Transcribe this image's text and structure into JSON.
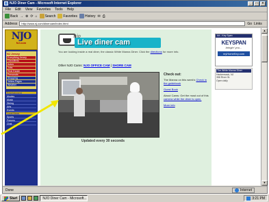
{
  "window": {
    "title": "NJO Diner Cam - Microsoft Internet Explorer",
    "controls": [
      "_",
      "□",
      "×"
    ]
  },
  "menubar": {
    "items": [
      "File",
      "Edit",
      "View",
      "Favorites",
      "Tools",
      "Help"
    ]
  },
  "toolbar": {
    "back": "Back",
    "forward": "→",
    "stop": "⊗",
    "refresh": "⟳",
    "home": "⌂",
    "search": "Search",
    "favorites": "Favorites",
    "history": "History",
    "mail": "✉",
    "print": "⎙"
  },
  "address": {
    "label": "Address",
    "url": "http://www.nj.com/dinercam/index.html",
    "go": "Go",
    "links": "Links"
  },
  "site": {
    "logo": "NJO",
    "logo_sub": "NJ.com",
    "nav_head": "NJ Jersey",
    "nav_red": [
      "Everything Jersey",
      "Classifieds",
      "Autos",
      "Jobs",
      "Real Estate",
      "Personals"
    ],
    "nav_blue": [
      "Shopping",
      "Yellow Pages",
      "Weather"
    ],
    "nav_section": "Entertainment",
    "nav_list": [
      "Movies",
      "Music",
      "Dining",
      "Arts",
      "Events"
    ],
    "nav_list2": [
      "Local News",
      "Sports",
      "Forums",
      "Chat"
    ]
  },
  "banner": {
    "small": "njo",
    "title": "Live diner cam"
  },
  "intro": {
    "text": "You are looking inside a real diner, the classic White Manna Diner. Click the",
    "link": "directions",
    "tail": "for more info."
  },
  "camline": {
    "label": "Other NJO Cams:",
    "links": [
      "NJO OFFICE CAM",
      "SHORE CAM"
    ]
  },
  "caption": "Updated every 30 seconds",
  "rightcol": {
    "head": "Check out:",
    "p1": "The Manna on this week's",
    "p1_link": "Check in the guidebook",
    "p2_link": "Guest Book",
    "p3": "About Cams: Get the most out of this",
    "p3_link": "camera while the diner is open.",
    "p4": "More info"
  },
  "ad": {
    "strip": "Ad - Key Span",
    "brand": "KEYSPAN",
    "tag": "bringin' you...",
    "domain": "myHomeKey.com"
  },
  "rightbox": {
    "head": "The White Manna Diner",
    "lines": [
      "Hackensack, NJ",
      "358 River St.",
      "Open daily"
    ]
  },
  "status": {
    "text": "Done",
    "zone": "Internet"
  },
  "taskbar": {
    "start": "Start",
    "task": "NJO Diner Cam - Microsoft...",
    "clock": "3:21 PM"
  }
}
